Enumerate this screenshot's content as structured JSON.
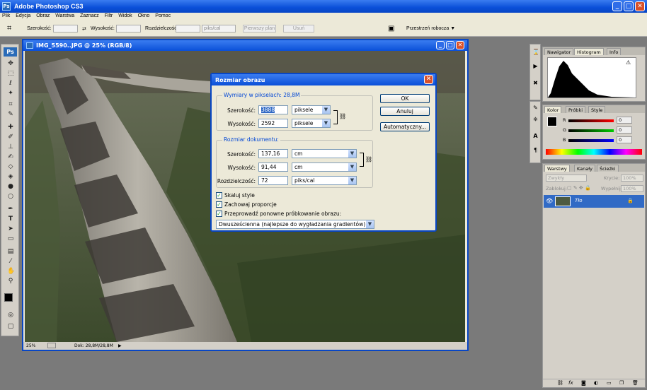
{
  "app": {
    "title": "Adobe Photoshop CS3",
    "logo": "Ps"
  },
  "menu": [
    "Plik",
    "Edycja",
    "Obraz",
    "Warstwa",
    "Zaznacz",
    "Filtr",
    "Widok",
    "Okno",
    "Pomoc"
  ],
  "options": {
    "width_label": "Szerokość:",
    "height_label": "Wysokość:",
    "res_label": "Rozdzielczość:",
    "res_unit": "piks/cal",
    "front_image": "Pierwszy plan",
    "clear": "Usuń",
    "workspace": "Przestrzeń robocza"
  },
  "document": {
    "title": "IMG_5590..JPG @ 25% (RGB/8)",
    "zoom": "25%",
    "doc_size": "Dok: 28,8M/28,8M"
  },
  "dialog": {
    "title": "Rozmiar obrazu",
    "pixel_group": "Wymiary w pikselach: 28,8M",
    "px_width_label": "Szerokość:",
    "px_width": "3888",
    "px_width_unit": "piksele",
    "px_height_label": "Wysokość:",
    "px_height": "2592",
    "px_height_unit": "piksele",
    "doc_group": "Rozmiar dokumentu:",
    "doc_width_label": "Szerokość:",
    "doc_width": "137,16",
    "doc_width_unit": "cm",
    "doc_height_label": "Wysokość:",
    "doc_height": "91,44",
    "doc_height_unit": "cm",
    "res_label": "Rozdzielczość:",
    "res": "72",
    "res_unit": "piks/cal",
    "scale_styles": "Skaluj style",
    "constrain": "Zachowaj proporcje",
    "resample": "Przeprowadź ponowne próbkowanie obrazu:",
    "method": "Dwusześcienna (najlepsze do wygładzania gradientów)",
    "ok": "OK",
    "cancel": "Anuluj",
    "auto": "Automatyczny..."
  },
  "panels": {
    "nav_tabs": [
      "Nawigator",
      "Histogram",
      "Info"
    ],
    "color_tabs": [
      "Kolor",
      "Próbki",
      "Style"
    ],
    "color_channels": [
      "R",
      "G",
      "B"
    ],
    "color_values": [
      "0",
      "0",
      "0"
    ],
    "layer_tabs": [
      "Warstwy",
      "Kanały",
      "Ścieżki"
    ],
    "blend": "Zwykły",
    "opacity_label": "Krycie:",
    "opacity": "100%",
    "lock_label": "Zablokuj:",
    "fill_label": "Wypełnij:",
    "fill": "100%",
    "layer_name": "Tło"
  },
  "colors": {
    "xp_blue": "#0a4fd8",
    "accent": "#2f6de8"
  }
}
